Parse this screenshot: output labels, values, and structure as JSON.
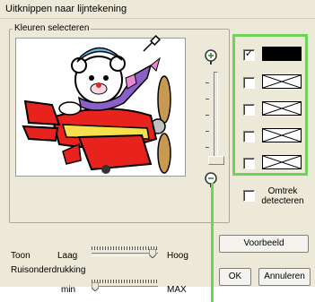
{
  "window": {
    "title": "Uitknippen naar lijntekening"
  },
  "colors_group": {
    "label": "Kleuren selecteren"
  },
  "zoom": {
    "in_icon": "zoom-in-icon",
    "out_icon": "zoom-out-icon"
  },
  "color_list": [
    {
      "checked": true,
      "swatch": "black"
    },
    {
      "checked": false,
      "swatch": "empty"
    },
    {
      "checked": false,
      "swatch": "empty"
    },
    {
      "checked": false,
      "swatch": "empty"
    },
    {
      "checked": false,
      "swatch": "empty"
    }
  ],
  "outline": {
    "label_line1": "Omtrek",
    "label_line2": "detecteren",
    "checked": false
  },
  "preview_button": "Voorbeeld",
  "tone": {
    "label": "Toon",
    "min_label": "Laag",
    "max_label": "Hoog"
  },
  "noise": {
    "label": "Ruisonderdrukking",
    "min_label": "min",
    "max_label": "MAX"
  },
  "buttons": {
    "ok": "OK",
    "cancel": "Annuleren"
  },
  "accent_color": "#6fd35a"
}
